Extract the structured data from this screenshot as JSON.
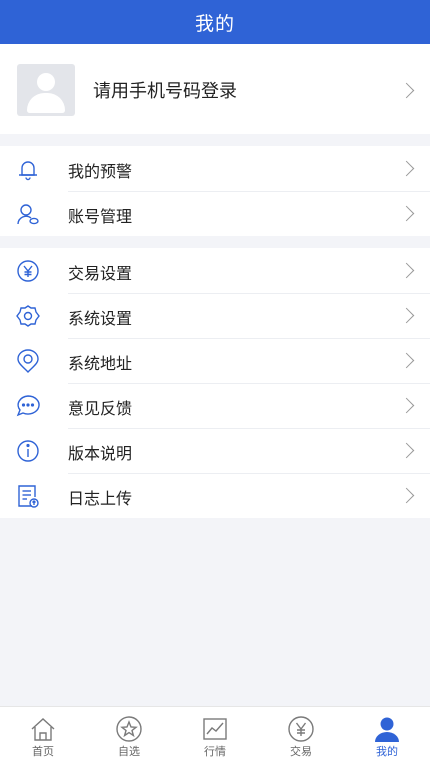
{
  "header": {
    "title": "我的"
  },
  "profile": {
    "login_text": "请用手机号码登录"
  },
  "menu_group1": [
    {
      "icon": "bell-icon",
      "label": "我的预警"
    },
    {
      "icon": "account-manage-icon",
      "label": "账号管理"
    }
  ],
  "menu_group2": [
    {
      "icon": "yen-circle-icon",
      "label": "交易设置"
    },
    {
      "icon": "gear-icon",
      "label": "系统设置"
    },
    {
      "icon": "location-pin-icon",
      "label": "系统地址"
    },
    {
      "icon": "chat-bubble-icon",
      "label": "意见反馈"
    },
    {
      "icon": "info-icon",
      "label": "版本说明"
    },
    {
      "icon": "log-upload-icon",
      "label": "日志上传"
    }
  ],
  "tabbar": [
    {
      "icon": "home-icon",
      "label": "首页"
    },
    {
      "icon": "star-icon",
      "label": "自选"
    },
    {
      "icon": "chart-icon",
      "label": "行情"
    },
    {
      "icon": "yen-icon",
      "label": "交易"
    },
    {
      "icon": "person-icon",
      "label": "我的",
      "active": true
    }
  ],
  "colors": {
    "accent": "#2f63d6",
    "icon_stroke": "#2f63d6",
    "background": "#f3f4f8"
  }
}
